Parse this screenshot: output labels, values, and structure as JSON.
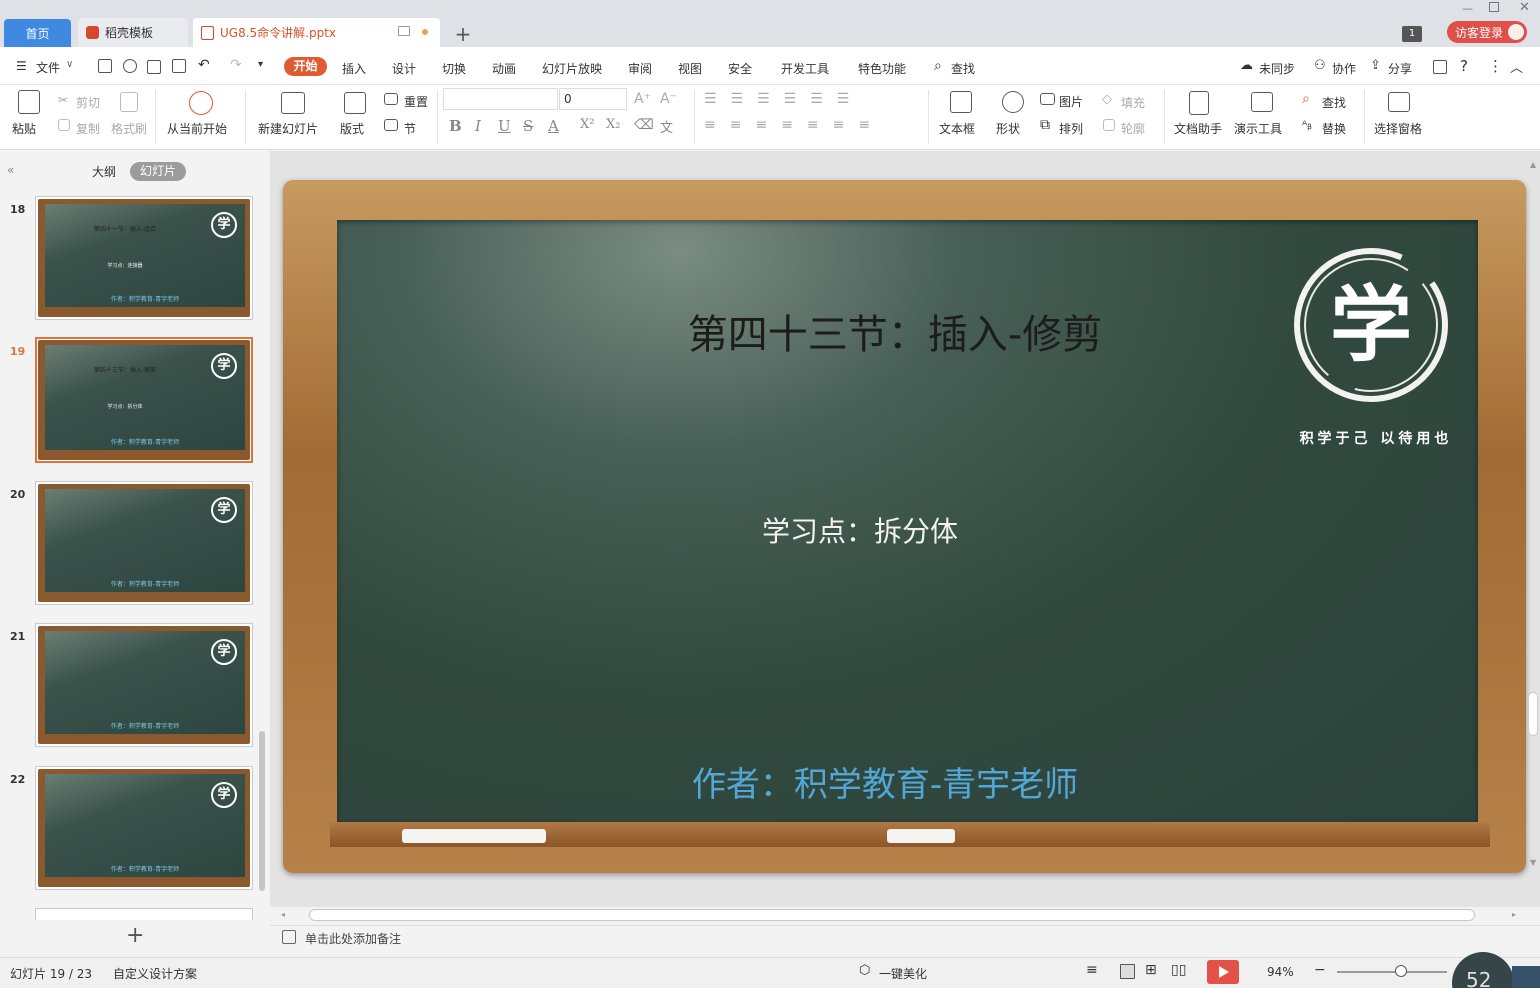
{
  "tabs": {
    "home": "首页",
    "templates": "稻壳模板",
    "file": "UG8.5命令讲解.pptx",
    "new_tab": "+"
  },
  "window": {
    "badge": "1",
    "login": "访客登录"
  },
  "menu": {
    "file": "文件",
    "start": "开始",
    "insert": "插入",
    "design": "设计",
    "transition": "切换",
    "animation": "动画",
    "slideshow": "幻灯片放映",
    "review": "审阅",
    "view": "视图",
    "security": "安全",
    "devtools": "开发工具",
    "special": "特色功能",
    "search": "查找",
    "sync": "未同步",
    "collab": "协作",
    "share": "分享"
  },
  "ribbon": {
    "paste": "粘贴",
    "cut": "剪切",
    "copy": "复制",
    "format_painter": "格式刷",
    "from_current": "从当前开始",
    "new_slide": "新建幻灯片",
    "layout": "版式",
    "reset": "重置",
    "section": "节",
    "font_size": "0",
    "textbox": "文本框",
    "shape": "形状",
    "picture": "图片",
    "arrange": "排列",
    "fill": "填充",
    "outline": "轮廓",
    "doc_helper": "文档助手",
    "present_tools": "演示工具",
    "find": "查找",
    "replace": "替换",
    "select_pane": "选择窗格"
  },
  "left_pane": {
    "outline": "大纲",
    "slides": "幻灯片",
    "thumbnails": [
      {
        "num": "18",
        "title": "第四十一节：插入-组合",
        "sub": "学习点：连接器",
        "author": "作者：积学教育-青宇老师"
      },
      {
        "num": "19",
        "title": "第四十三节：插入-修剪",
        "sub": "学习点：拆分体",
        "author": "作者：积学教育-青宇老师"
      },
      {
        "num": "20",
        "title": "",
        "sub": "",
        "author": "作者：积学教育-青宇老师"
      },
      {
        "num": "21",
        "title": "",
        "sub": "",
        "author": "作者：积学教育-青宇老师"
      },
      {
        "num": "22",
        "title": "",
        "sub": "",
        "author": "作者：积学教育-青宇老师"
      }
    ],
    "add": "+"
  },
  "slide": {
    "title": "第四十三节：插入-修剪",
    "subtitle": "学习点：拆分体",
    "author": "作者：积学教育-青宇老师",
    "logo_char": "学",
    "logo_motto": "积学于己 以待用也"
  },
  "notes": {
    "placeholder": "单击此处添加备注"
  },
  "status": {
    "slide_counter": "幻灯片 19 / 23",
    "design_scheme": "自定义设计方案",
    "beautify": "一键美化",
    "zoom": "94%",
    "speed": "52"
  },
  "colors": {
    "accent": "#e05a32",
    "tab_home": "#3f8ae0",
    "board": "#2f463f",
    "frame": "#b07842",
    "author_text": "#52a7d6"
  }
}
